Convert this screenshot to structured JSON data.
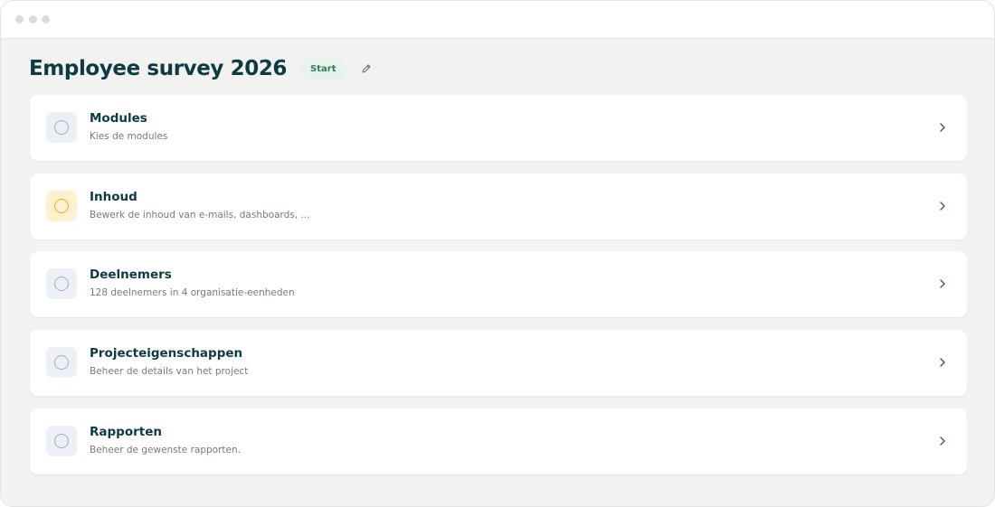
{
  "header": {
    "title": "Employee survey 2026",
    "status": "Start",
    "edit_icon": "pencil-icon"
  },
  "colors": {
    "title": "#0e3a44",
    "badge_bg": "#e7f2ec",
    "badge_text": "#2f7d5b",
    "active_ring": "#e8ae2a",
    "inactive_ring": "#a9adbc"
  },
  "steps": [
    {
      "title": "Modules",
      "subtitle": "Kies de modules",
      "state": "todo",
      "icon": "circle-icon"
    },
    {
      "title": "Inhoud",
      "subtitle": "Bewerk de inhoud van e-mails, dashboards, ...",
      "state": "in-progress",
      "icon": "circle-icon"
    },
    {
      "title": "Deelnemers",
      "subtitle": "128 deelnemers in 4 organisatie-eenheden",
      "state": "todo",
      "icon": "circle-icon"
    },
    {
      "title": "Projecteigenschappen",
      "subtitle": "Beheer de details van het project",
      "state": "todo",
      "icon": "circle-icon"
    },
    {
      "title": "Rapporten",
      "subtitle": "Beheer de gewenste rapporten.",
      "state": "todo",
      "icon": "circle-icon"
    }
  ]
}
